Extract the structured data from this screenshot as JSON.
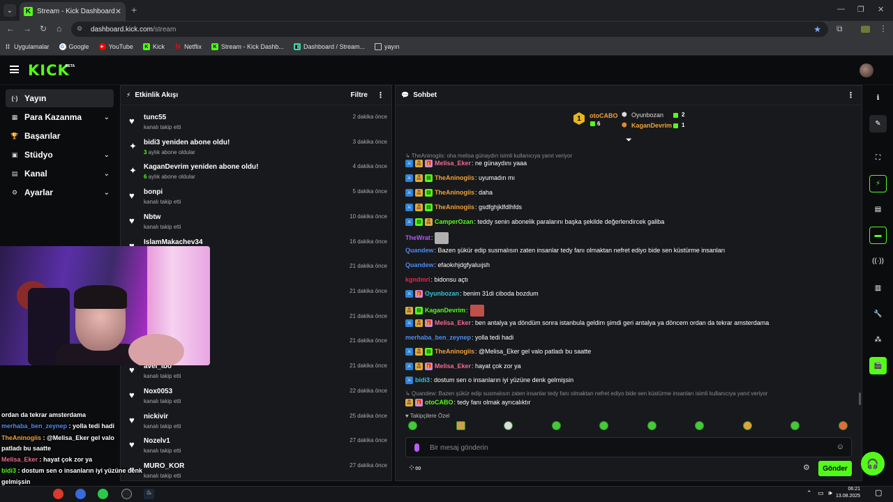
{
  "browser": {
    "tab_title": "Stream - Kick Dashboard",
    "url_host": "dashboard.kick.com",
    "url_path": "/stream",
    "bookmarks": [
      "Uygulamalar",
      "Google",
      "YouTube",
      "Kick",
      "Netflix",
      "Stream - Kick Dashb...",
      "Dashboard / Stream...",
      "yayın"
    ]
  },
  "header": {
    "logo": "KICK",
    "beta": "BETA"
  },
  "nav": [
    {
      "label": "Yayın",
      "icon": "(·)"
    },
    {
      "label": "Para Kazanma",
      "icon": "▦"
    },
    {
      "label": "Başarılar",
      "icon": "🏆"
    },
    {
      "label": "Stüdyo",
      "icon": "▣"
    },
    {
      "label": "Kanal",
      "icon": "▤"
    },
    {
      "label": "Ayarlar",
      "icon": "⚙"
    }
  ],
  "events": {
    "title": "Etkinlik Akışı",
    "filter": "Filtre",
    "items": [
      {
        "name": "tunc55",
        "sub": "kanalı takip etti",
        "time": "2 dakika önce",
        "icon": "heart"
      },
      {
        "name": "bidi3 yeniden abone oldu!",
        "count": "3",
        "sub": " aylık abone oldular",
        "time": "3 dakika önce",
        "icon": "sparkle"
      },
      {
        "name": "KaganDevrim yeniden abone oldu!",
        "count": "6",
        "sub": " aylık abone oldular",
        "time": "4 dakika önce",
        "icon": "sparkle"
      },
      {
        "name": "bonpi",
        "sub": "kanalı takip etti",
        "time": "5 dakika önce",
        "icon": "heart"
      },
      {
        "name": "Nbtw",
        "sub": "kanalı takip etti",
        "time": "10 dakika önce",
        "icon": "heart"
      },
      {
        "name": "IslamMakachev34",
        "sub": "",
        "time": "16 dakika önce",
        "icon": "heart"
      },
      {
        "name": "",
        "sub": "",
        "time": "21 dakika önce",
        "icon": "heart"
      },
      {
        "name": "",
        "sub": "",
        "time": "21 dakika önce",
        "icon": "heart"
      },
      {
        "name": "",
        "sub": "",
        "time": "21 dakika önce",
        "icon": "heart"
      },
      {
        "name": "",
        "sub": "",
        "time": "21 dakika önce",
        "icon": "heart"
      },
      {
        "name": "avel_ibo",
        "sub": "kanalı takip etti",
        "time": "21 dakika önce",
        "icon": "heart"
      },
      {
        "name": "Nox0053",
        "sub": "kanalı takip etti",
        "time": "22 dakika önce",
        "icon": "heart"
      },
      {
        "name": "nickivir",
        "sub": "kanalı takip etti",
        "time": "25 dakika önce",
        "icon": "heart"
      },
      {
        "name": "Nozelv1",
        "sub": "kanalı takip etti",
        "time": "27 dakika önce",
        "icon": "heart"
      },
      {
        "name": "MURO_KOR",
        "sub": "kanalı takip etti",
        "time": "27 dakika önce",
        "icon": "heart"
      }
    ]
  },
  "chat": {
    "title": "Sohbet",
    "podium": {
      "first_name": "otoCABO",
      "first_count": "6",
      "second_name": "Oyunbozan",
      "second_count": "2",
      "third_name": "KaganDevrim",
      "third_count": "1",
      "rank_label": "1"
    },
    "messages": [
      {
        "type": "reply",
        "text": "↳ TheAninogiis: oha melisa günaydın isimli kullanıcıya yanıt veriyor"
      },
      {
        "badges": [
          "blue",
          "yel",
          "pur"
        ],
        "user": "Melisa_Eker",
        "color": "#f06a8f",
        "text": ": ne günaydını yaaa"
      },
      {
        "badges": [
          "blue",
          "yel",
          "grn"
        ],
        "user": "TheAninogiis",
        "color": "#f2a23a",
        "text": ": uyumadın mı"
      },
      {
        "badges": [
          "blue",
          "yel",
          "grn"
        ],
        "user": "TheAninogiis",
        "color": "#f2a23a",
        "text": ": daha"
      },
      {
        "badges": [
          "blue",
          "yel",
          "grn"
        ],
        "user": "TheAninogiis",
        "color": "#f2a23a",
        "text": ": gsdfghjklfdlhfds"
      },
      {
        "badges": [
          "blue",
          "grn",
          "yel"
        ],
        "user": "CamperOzan",
        "color": "#53fc18",
        "text": ": teddy senin abonelik paralarını başka şekilde değerlendircek galiba"
      },
      {
        "badges": [],
        "user": "TheWrat",
        "color": "#b05cf5",
        "text": ":",
        "sticker": "#b0b0b0"
      },
      {
        "badges": [],
        "user": "Quandew",
        "color": "#4d8cf0",
        "text": ": Bazen şükür edip susmalısın zaten insanlar tedy fanı olmaktan nefret ediyo bide sen küstürme insanları"
      },
      {
        "badges": [],
        "user": "Quandew",
        "color": "#4d8cf0",
        "text": ": efaokıhjdgfyaluıjsh"
      },
      {
        "badges": [],
        "user": "kgndmrl",
        "color": "#e0284a",
        "text": ": bidonsu açtı"
      },
      {
        "badges": [
          "blue",
          "pur"
        ],
        "user": "Oyunbozan",
        "color": "#2fc4d6",
        "text": ": benim 31di ciboda bozdum"
      },
      {
        "badges": [
          "yel",
          "grn"
        ],
        "user": "KaganDevrim",
        "color": "#53fc18",
        "text": ":",
        "sticker": "#c0504a"
      },
      {
        "badges": [
          "blue",
          "yel",
          "pur"
        ],
        "user": "Melisa_Eker",
        "color": "#f06a8f",
        "text": ": ben antalya ya döndüm sonra istanbula geldim şimdi geri antalya ya döncem ordan da tekrar amsterdama"
      },
      {
        "badges": [],
        "user": "merhaba_ben_zeynep",
        "color": "#4d8cf0",
        "text": ": yolla tedi hadi"
      },
      {
        "badges": [
          "blue",
          "yel",
          "grn"
        ],
        "user": "TheAninogiis",
        "color": "#f2a23a",
        "text": ": @Melisa_Eker gel valo patladı bu saatte"
      },
      {
        "badges": [
          "blue",
          "yel",
          "pur"
        ],
        "user": "Melisa_Eker",
        "color": "#f06a8f",
        "text": ": hayat çok zor ya"
      },
      {
        "badges": [
          "blue"
        ],
        "user": "bidi3",
        "color": "#2fc4d6",
        "text": ": dostum sen o insanların iyi yüzüne denk gelmişsin"
      },
      {
        "type": "reply",
        "text": "↳ Quandew: Bazen şükür edip susmalısın zaten insanlar tedy fanı olmaktan nefret ediyo bide sen küstürme insanları isimli kullanıcıya yanıt veriyor"
      },
      {
        "badges": [
          "yel",
          "pur"
        ],
        "user": "otoCABO",
        "color": "#53fc18",
        "text": ": tedy fanı olmak ayrıcalıktır"
      }
    ],
    "followers_label": "Takipçilere Özel",
    "placeholder": "Bir mesaj gönderin",
    "send": "Gönder"
  },
  "overlay": [
    {
      "text": "ordan da tekrar amsterdama"
    },
    {
      "user": "merhaba_ben_zeynep",
      "color": "#4d8cf0",
      "text": " : yolla tedi hadi"
    },
    {
      "user": "TheAninogiis",
      "color": "#f2a23a",
      "text": " : @Melisa_Eker gel valo"
    },
    {
      "text": "patladı bu saatte"
    },
    {
      "user": "Melisa_Eker",
      "color": "#f06a8f",
      "text": " : hayat çok zor ya"
    },
    {
      "user": "bidi3",
      "color": "#53fc18",
      "text": " : dostum sen o insanların iyi yüzüne denk"
    },
    {
      "text": "gelmişsin"
    },
    {
      "user": "otoCABO",
      "color": "#53fc18",
      "text": " : tedy fanı olmak ayrıcalıktır"
    }
  ],
  "taskbar": {
    "time": "06:21",
    "date": "13.08.2025"
  },
  "colors": {
    "accent": "#53fc18",
    "panel": "#18191c",
    "bg": "#0b0c0e"
  }
}
